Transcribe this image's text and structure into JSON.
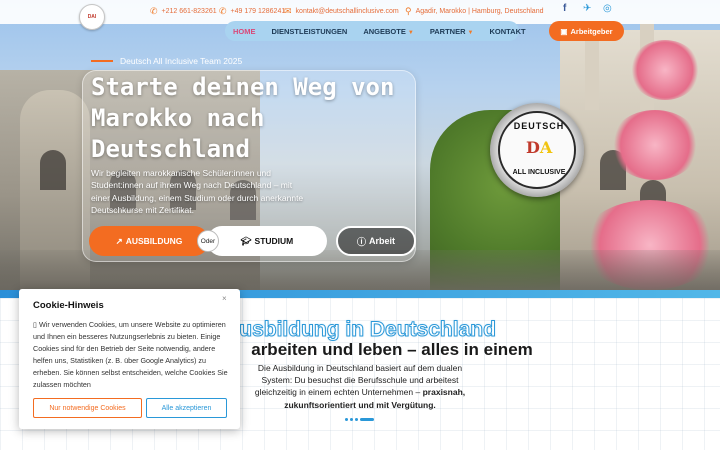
{
  "header": {
    "phone_1": "+212 661-823261",
    "phone_2": "+49 179 1286241",
    "email": "kontakt@deutschallinclusive.com",
    "location": "Agadir, Marokko | Hamburg, Deutschland",
    "social_icons": [
      "facebook-icon",
      "telegram-icon",
      "instagram-icon"
    ]
  },
  "nav": {
    "items": [
      {
        "label": "HOME",
        "active": true
      },
      {
        "label": "DIENSTLEISTUNGEN"
      },
      {
        "label": "ANGEBOTE",
        "caret": true
      },
      {
        "label": "PARTNER",
        "caret": true
      },
      {
        "label": "KONTAKT"
      }
    ],
    "employer_button": "Arbeitgeber"
  },
  "hero": {
    "team_label": "Deutsch All Inclusive Team 2025",
    "title": "Starte deinen Weg von Marokko nach Deutschland",
    "text": "Wir begleiten marokkanische Schüler:innen und Student:innen auf ihrem Weg nach Deutschland – mit einer Ausbildung, einem Studium oder durch anerkannte Deutschkurse mit Zertifikat.",
    "btn_ausbildung": "AUSBILDUNG",
    "oder": "Oder",
    "btn_studium": "STUDIUM",
    "btn_arbeit": "Arbeit",
    "seal": {
      "top": "DEUTSCH",
      "bottom": "ALL INCLUSIVE"
    }
  },
  "section": {
    "title": "Ausbildung in Deutschland",
    "subtitle": "arbeiten und leben – alles in einem",
    "text_plain": "Die Ausbildung in Deutschland basiert auf dem dualen System: Du besuchst die Berufsschule und arbeitest gleichzeitig in einem echten Unternehmen –",
    "text_bold_1": "praxisnah,",
    "text_bold_2": "zukunftsorientiert und mit Vergütung."
  },
  "cookie": {
    "title": "Cookie-Hinweis",
    "close": "×",
    "text": "Wir verwenden Cookies, um unsere Website zu optimieren und Ihnen ein besseres Nutzungserlebnis zu bieten. Einige Cookies sind für den Betrieb der Seite notwendig, andere helfen uns, Statistiken (z. B. über Google Analytics) zu erheben. Sie können selbst entscheiden, welche Cookies Sie zulassen möchten",
    "btn_necessary": "Nur notwendige Cookies",
    "btn_accept": "Alle akzeptieren"
  },
  "colors": {
    "accent_orange": "#f36c21",
    "accent_blue": "#2a98d8",
    "nav_bg": "#a9d3f0"
  }
}
